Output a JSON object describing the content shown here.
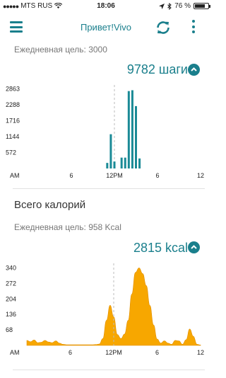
{
  "status_bar": {
    "carrier": "MTS RUS",
    "time": "18:06",
    "battery_text": "76 %",
    "battery_level": 0.76
  },
  "header": {
    "title": "Привет!Vivo"
  },
  "steps": {
    "goal": "Ежедневная цель: 3000",
    "total": "9782 шаги",
    "chart_data": {
      "type": "bar",
      "x": [
        11,
        11.5,
        12,
        13,
        13.5,
        14,
        14.5,
        15,
        15.5,
        16
      ],
      "values": [
        200,
        1230,
        250,
        390,
        390,
        2780,
        2810,
        2240,
        360,
        0
      ],
      "bar_color": "#1a8a96",
      "ylim": [
        0,
        3000
      ],
      "yticks": [
        572,
        1144,
        1716,
        2288,
        2863
      ],
      "ytick_labels": [
        "572",
        "1144",
        "1716",
        "2288",
        "2863"
      ],
      "xlim": [
        0,
        24
      ],
      "xticks": [
        0,
        6,
        12,
        18,
        24
      ],
      "xtick_labels": [
        "AM",
        "6",
        "12PM",
        "6",
        "12"
      ],
      "marker_x": 12
    }
  },
  "calories": {
    "title": "Всего калорий",
    "goal": "Ежедневная цель: 958 Kcal",
    "total": "2815 kcal",
    "chart_data": {
      "type": "area",
      "x": [
        0,
        0.5,
        1,
        1.5,
        2,
        2.5,
        3,
        3.5,
        4,
        4.5,
        5,
        5.5,
        6,
        6.5,
        7,
        7.5,
        8,
        8.5,
        9,
        9.5,
        10,
        10.5,
        11,
        11.5,
        12,
        12.5,
        13,
        13.5,
        14,
        14.5,
        15,
        15.5,
        16,
        16.5,
        17,
        17.5,
        18,
        18.5,
        19,
        19.5,
        20,
        20.5,
        21,
        21.5,
        22,
        22.5,
        23,
        23.5,
        24
      ],
      "values": [
        22,
        16,
        24,
        12,
        14,
        22,
        15,
        12,
        20,
        10,
        5,
        3,
        3,
        3,
        3,
        3,
        3,
        3,
        3,
        4,
        6,
        30,
        110,
        176,
        125,
        48,
        30,
        50,
        110,
        225,
        320,
        340,
        315,
        262,
        175,
        90,
        28,
        10,
        20,
        10,
        5,
        22,
        20,
        5,
        25,
        72,
        40,
        5,
        2
      ],
      "fill_color": "#f7a700",
      "ylim": [
        0,
        360
      ],
      "yticks": [
        68,
        136,
        204,
        272,
        340
      ],
      "ytick_labels": [
        "68",
        "136",
        "204",
        "272",
        "340"
      ],
      "xlim": [
        0,
        24
      ],
      "xticks": [
        0,
        6,
        12,
        18,
        24
      ],
      "xtick_labels": [
        "AM",
        "6",
        "12PM",
        "6",
        "12"
      ],
      "marker_x": 12
    }
  }
}
